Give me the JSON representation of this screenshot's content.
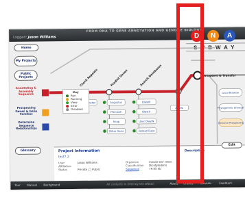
{
  "header": {
    "slogan": "FROM DNA TO GENE ANNOTATION AND GENOME BIOLOGY",
    "user_prefix": "Logged:",
    "user_name": "Jason Williams"
  },
  "logo": {
    "letters": [
      {
        "char": "D",
        "color": "#e3201f"
      },
      {
        "char": "N",
        "color": "#f28c1a"
      },
      {
        "char": "A",
        "color": "#2a57b8"
      }
    ],
    "word": "SUBWAY"
  },
  "sidebar": {
    "home": "Home",
    "my_projects": "My Projects",
    "public_projects": "Public Projects",
    "glossary": "Glossary"
  },
  "lines": [
    {
      "label": "Annotating & Assembly Sequence",
      "color": "#c8202a"
    },
    {
      "label": "Prospecting Genes & Gene Families",
      "color": "#f0a020"
    },
    {
      "label": "Determine Sequence Relationships",
      "color": "#2a4aa8"
    }
  ],
  "stations": {
    "check_proj": "Check Repeats",
    "predict_genes": "Predict Genes",
    "search_databases": "Search Databases",
    "browser_transfer": "Browsers & Transfer"
  },
  "tool_boxes": {
    "col1": [
      "RepeatMasker"
    ],
    "col2": [
      "Augustus",
      "FGenesh",
      "Snap",
      "Other Gene"
    ],
    "col3": [
      "BlastN",
      "BlastX",
      "User BlastN",
      "Upload Data"
    ],
    "extra": "Apollo",
    "right": [
      "Local Browser",
      "Phylogenetic Browser",
      "Genome Prospecting"
    ]
  },
  "key": {
    "title": "Key",
    "items": [
      {
        "label": "Run",
        "color": "#2a7a2a"
      },
      {
        "label": "Running",
        "color": "#e0a000"
      },
      {
        "label": "View",
        "color": "#2aa02a"
      },
      {
        "label": "Error",
        "color": "#c01818"
      },
      {
        "label": "Disabled",
        "color": "#888888"
      }
    ]
  },
  "project": {
    "title": "Project Information",
    "name": "test7.2",
    "description_label": "Description",
    "edit_label": "Edit",
    "fields": [
      {
        "label": "User",
        "value": "Jason Williams"
      },
      {
        "label": "Affiliation",
        "value": ""
      },
      {
        "label": "Status",
        "value": "Private ◯ Public"
      }
    ],
    "fields2": [
      {
        "label": "Organism",
        "value": "mouse-ear cress"
      },
      {
        "label": "Classification",
        "value": "Dicotyledons"
      },
      {
        "label": "Sequence",
        "value": "79.05 kb"
      }
    ]
  },
  "footer": {
    "left_items": [
      "Tour",
      "Manual",
      "Background"
    ],
    "center": "All contents © 2010 by the DNALC",
    "right_items": [
      "About",
      "Credits",
      "Tutorials",
      "Feedback"
    ]
  }
}
